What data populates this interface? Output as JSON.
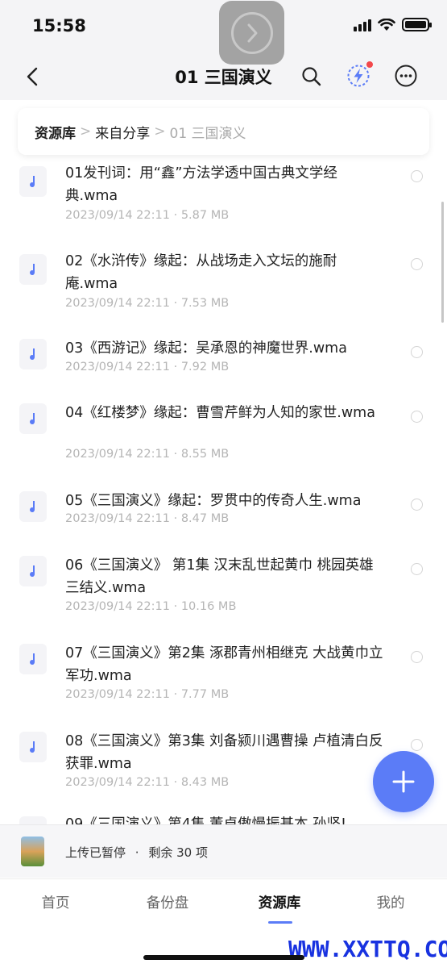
{
  "status": {
    "time": "15:58"
  },
  "nav": {
    "title": "01 三国演义"
  },
  "breadcrumb": {
    "root": "资源库",
    "middle": "来自分享",
    "current": "01 三国演义",
    "separator": ">"
  },
  "files": [
    {
      "name": "01发刊词：用“鑫”方法学透中国古典文学经典.wma",
      "date": "2023/09/14 22:11",
      "size": "5.87 MB"
    },
    {
      "name": "02《水浒传》缘起：从战场走入文坛的施耐庵.wma",
      "date": "2023/09/14 22:11",
      "size": "7.53 MB"
    },
    {
      "name": "03《西游记》缘起：吴承恩的神魔世界.wma",
      "date": "2023/09/14 22:11",
      "size": "7.92 MB"
    },
    {
      "name": "04《红楼梦》缘起：曹雪芹鲜为人知的家世.wma",
      "date": "2023/09/14 22:11",
      "size": "8.55 MB"
    },
    {
      "name": "05《三国演义》缘起：罗贯中的传奇人生.wma",
      "date": "2023/09/14 22:11",
      "size": "8.47 MB"
    },
    {
      "name": "06《三国演义》 第1集 汉末乱世起黄巾 桃园英雄三结义.wma",
      "date": "2023/09/14 22:11",
      "size": "10.16 MB"
    },
    {
      "name": "07《三国演义》第2集 涿郡青州相继克 大战黄巾立军功.wma",
      "date": "2023/09/14 22:11",
      "size": "7.77 MB"
    },
    {
      "name": "08《三国演义》第3集 刘备颍川遇曹操 卢植清白反获罪.wma",
      "date": "2023/09/14 22:11",
      "size": "8.43 MB"
    },
    {
      "name": "09《三国演义》第4集 董卓傲慢振基本 孙坚!",
      "date": "",
      "size": ""
    }
  ],
  "meta_separator": " · ",
  "upload": {
    "status": "上传已暂停",
    "separator": "·",
    "remaining": "剩余 30 项"
  },
  "tabs": [
    {
      "label": "首页"
    },
    {
      "label": "备份盘"
    },
    {
      "label": "资源库"
    },
    {
      "label": "我的"
    }
  ],
  "watermark": "WWW.XXTTQ.COM",
  "colors": {
    "accent": "#5b7cf7",
    "notification": "#f2484b",
    "watermark": "#1832e0"
  }
}
